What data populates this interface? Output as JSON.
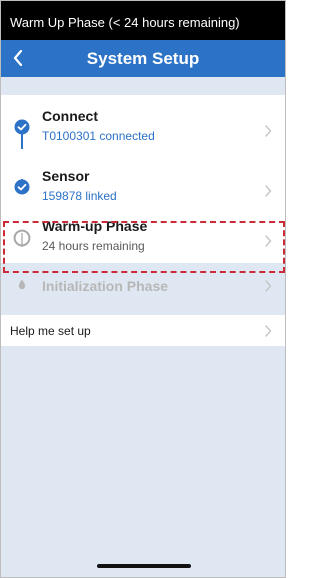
{
  "status_bar": {
    "text": "Warm Up Phase (< 24 hours remaining)"
  },
  "nav": {
    "title": "System Setup",
    "back_icon": "chevron-left-icon"
  },
  "steps": [
    {
      "title": "Connect",
      "subtitle": "T0100301 connected",
      "state": "complete"
    },
    {
      "title": "Sensor",
      "subtitle": "159878 linked",
      "state": "complete"
    },
    {
      "title": "Warm-up Phase",
      "subtitle": "24 hours remaining",
      "state": "in-progress"
    },
    {
      "title": "Initialization Phase",
      "subtitle": "",
      "state": "pending"
    }
  ],
  "help": {
    "label": "Help me set up"
  },
  "colors": {
    "accent": "#2c72c6",
    "highlight": "#cc2a36",
    "background": "#dfe8f2"
  }
}
